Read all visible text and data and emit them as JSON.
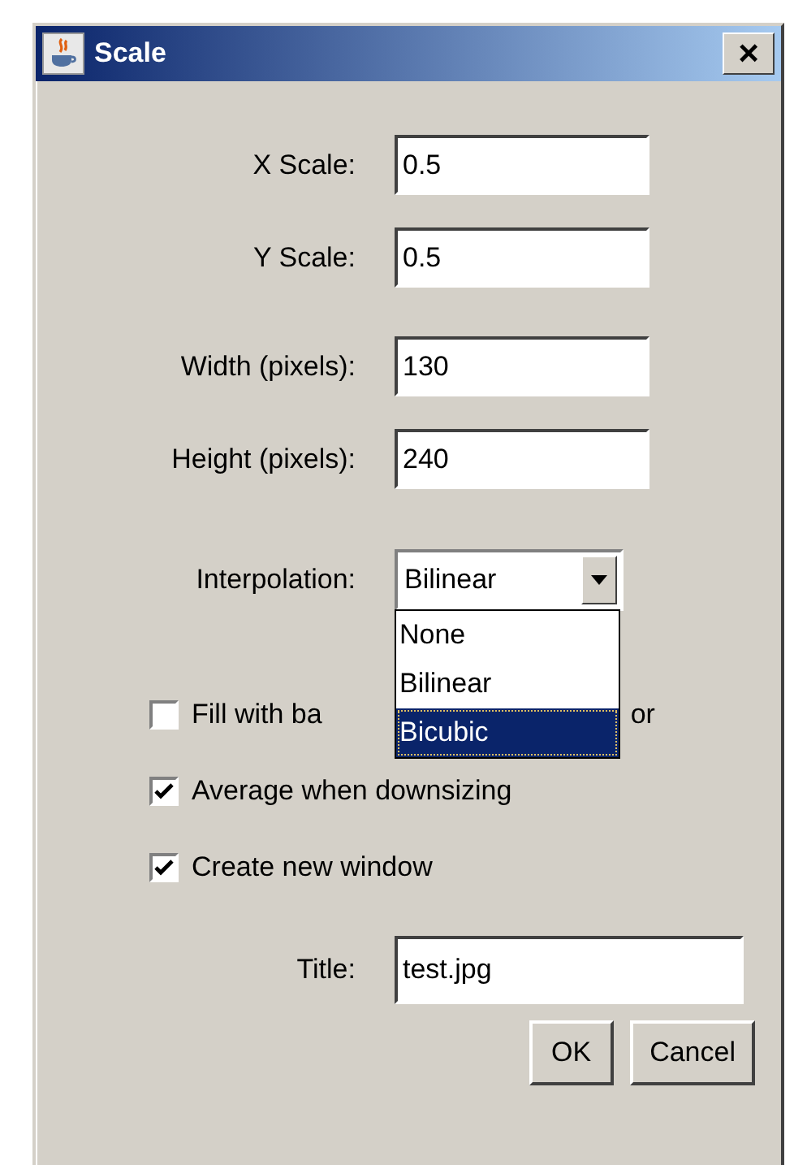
{
  "window": {
    "title": "Scale",
    "close": "×"
  },
  "fields": [
    {
      "label": "X Scale:",
      "value": "0.5"
    },
    {
      "label": "Y Scale:",
      "value": "0.5"
    },
    {
      "label": "Width (pixels):",
      "value": "130"
    },
    {
      "label": "Height (pixels):",
      "value": "240"
    }
  ],
  "interpolation": {
    "label": "Interpolation:",
    "value": "Bilinear",
    "expanded": true,
    "options": [
      {
        "label": "None",
        "highlighted": false
      },
      {
        "label": "Bilinear",
        "highlighted": false
      },
      {
        "label": "Bicubic",
        "highlighted": true
      }
    ]
  },
  "checkboxes": [
    {
      "label": "Fill with ba",
      "label_end": "or",
      "checked": false
    },
    {
      "label": "Average when downsizing",
      "checked": true
    },
    {
      "label": "Create new window",
      "checked": true
    }
  ],
  "title_field": {
    "label": "Title:",
    "value": "test.jpg"
  },
  "buttons": [
    "OK",
    "Cancel"
  ]
}
